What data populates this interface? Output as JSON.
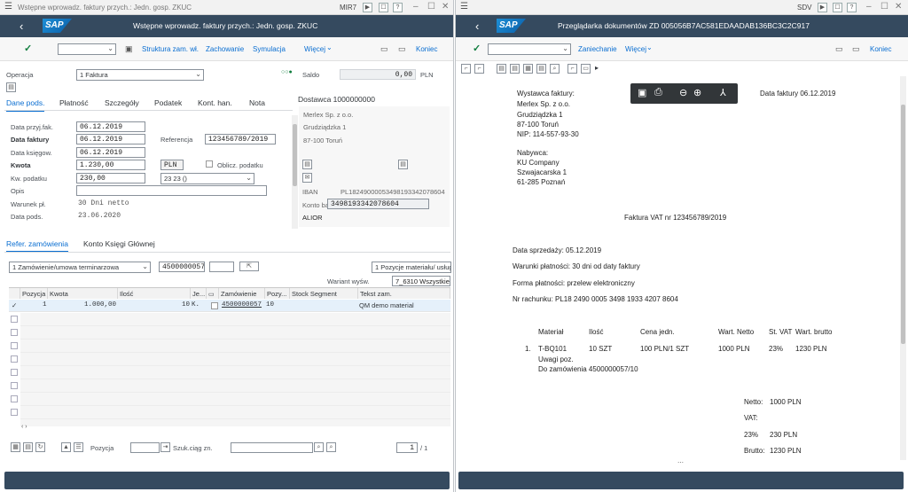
{
  "left": {
    "title": "Wstępne wprowadz. faktury przych.: Jedn. gosp. ZKUC",
    "tcode": "MIR7",
    "shell_title": "Wstępne wprowadz. faktury przych.: Jedn. gosp. ZKUC",
    "toolbar": {
      "struktura": "Struktura zam. wł.",
      "zachowanie": "Zachowanie",
      "symulacja": "Symulacja",
      "wiecej": "Więcej",
      "koniec": "Koniec"
    },
    "operacja_label": "Operacja",
    "operacja_value": "1 Faktura",
    "saldo_label": "Saldo",
    "saldo_value": "0,00",
    "saldo_currency": "PLN",
    "tabs": [
      "Dane pods.",
      "Płatność",
      "Szczegóły",
      "Podatek",
      "Kont. han.",
      "Nota"
    ],
    "fields": {
      "data_przyj_label": "Data przyj.fak.",
      "data_przyj": "06.12.2019",
      "data_faktury_label": "Data faktury",
      "data_faktury": "06.12.2019",
      "referencja_label": "Referencja",
      "referencja": "123456789/2019",
      "data_ksieg_label": "Data księgow.",
      "data_ksieg": "06.12.2019",
      "kwota_label": "Kwota",
      "kwota": "1.230,00",
      "waluta": "PLN",
      "oblicz_label": "Oblicz. podatku",
      "kw_podatku_label": "Kw. podatku",
      "kw_podatku": "230,00",
      "kod_podatku": "23 23 ()",
      "opis_label": "Opis",
      "warunek_label": "Warunek pł.",
      "warunek": "30 Dni netto",
      "data_pods_label": "Data pods.",
      "data_pods": "23.06.2020"
    },
    "dostawca": {
      "header": "Dostawca 1000000000",
      "name": "Merlex Sp. z o.o.",
      "street": "Grudziądzka 1",
      "city": "87-100 Toruń",
      "iban_label": "IBAN",
      "iban": "PL18249000053498193342078604",
      "konto_label": "Konto bank.",
      "konto": "3498193342078604",
      "bank": "ALIOR"
    },
    "lower_tabs": [
      "Refer. zamówienia",
      "Konto Księgi Głównej"
    ],
    "ref": {
      "type": "1 Zamówienie/umowa terminarzowa",
      "po": "4500000057",
      "items_combo": "1 Pozycje materiału/ usług",
      "wariant_label": "Wariant wyśw.",
      "wariant": "7_6310 Wszystkie"
    },
    "grid": {
      "headers": [
        "Pozycja",
        "Kwota",
        "Ilość",
        "Je...",
        "",
        "Zamówienie",
        "Pozy...",
        "Stock Segment",
        "Tekst zam."
      ],
      "row": {
        "pozycja": "1",
        "kwota": "1.000,00",
        "ilosc": "10",
        "je": "K.",
        "zamowienie": "4500000057",
        "pozy": "10",
        "tekst": "QM demo material"
      }
    },
    "bottom": {
      "pozycja_label": "Pozycja",
      "szuk_label": "Szuk.ciąg zn.",
      "page": "1",
      "of": "/ 1"
    }
  },
  "right": {
    "tcode": "SDV",
    "shell_title": "Przeglądarka dokumentów ZD 005056B7AC581EDAADAB136BC3C2C917",
    "toolbar": {
      "zaniechanie": "Zaniechanie",
      "wiecej": "Więcej",
      "koniec": "Koniec"
    },
    "doc": {
      "wystawca": [
        "Wystawca faktury:",
        "Merlex Sp. z o.o.",
        "Grudziądzka 1",
        "87-100 Toruń",
        "NIP: 114-557-93-30"
      ],
      "data_faktury": "Data faktury 06.12.2019",
      "nabywca": [
        "Nabywca:",
        "KU Company",
        "Szwajacarska 1",
        "61-285 Poznań"
      ],
      "title": "Faktura VAT nr 123456789/2019",
      "info": [
        "Data sprzedaży: 05.12.2019",
        "Warunki płatności: 30 dni od daty faktury",
        "Forma płatności: przelew elektroniczny",
        "Nr rachunku: PL18 2490 0005 3498 1933 4207 8604"
      ],
      "table_headers": [
        "Materiał",
        "Ilość",
        "Cena jedn.",
        "Wart. Netto",
        "St. VAT",
        "Wart. brutto"
      ],
      "line": {
        "no": "1.",
        "material": "T-BQ101",
        "ilosc": "10 SZT",
        "cena": "100 PLN/1 SZT",
        "netto": "1000 PLN",
        "vat": "23%",
        "brutto": "1230 PLN",
        "uwagi": "Uwagi poz.",
        "zamowienie": "Do zamówienia 4500000057/10"
      },
      "netto_label": "Netto:",
      "netto": "1000 PLN",
      "vat_label": "VAT:",
      "vat_rate": "23%",
      "vat_value": "230 PLN",
      "brutto_label": "Brutto:",
      "brutto": "1230 PLN"
    }
  },
  "colors": {
    "shell": "#354a5f",
    "accent": "#0a6ed1",
    "ok": "#107e3e"
  }
}
